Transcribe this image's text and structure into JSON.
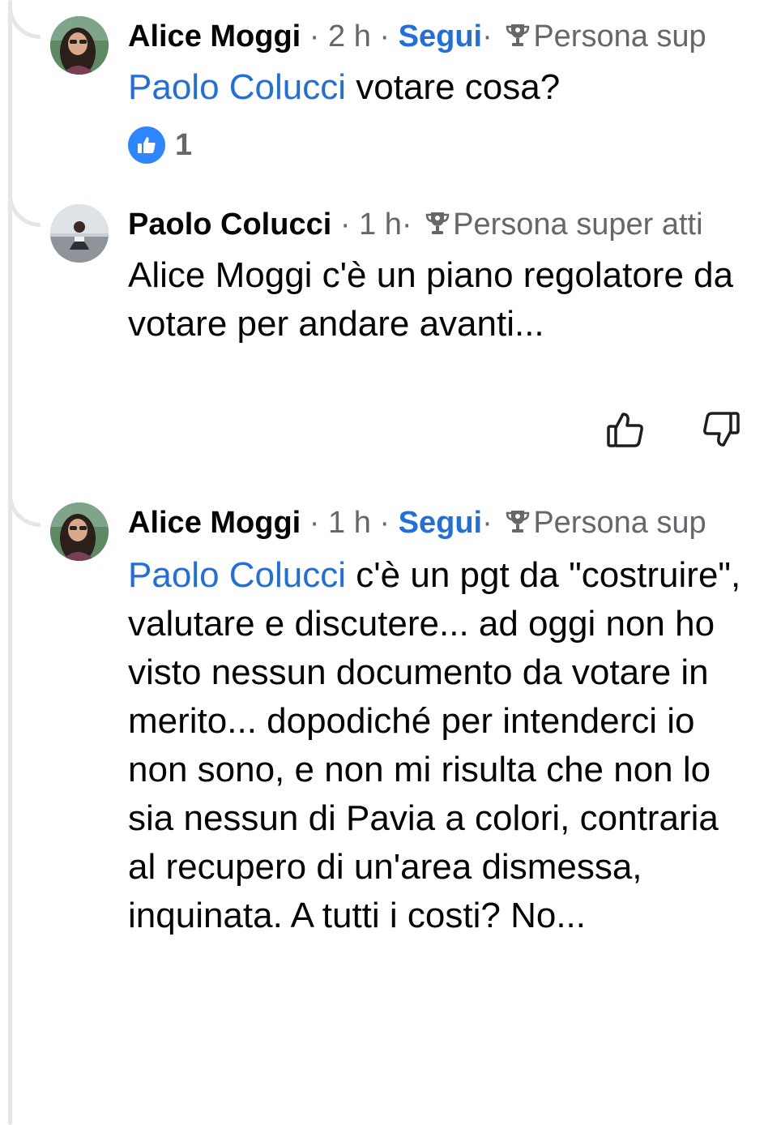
{
  "comments": [
    {
      "author": "Alice Moggi",
      "time": "· 2 h",
      "sep": "·",
      "follow": "Segui",
      "badge_sep": "·",
      "badge": "Persona sup",
      "mention": "Paolo Colucci",
      "text": " votare cosa?",
      "reaction_count": "1"
    },
    {
      "author": "Paolo Colucci",
      "time": "· 1 h",
      "badge_sep": "·",
      "badge": "Persona super atti",
      "text": "Alice Moggi c'è un piano regolatore da votare per andare avanti..."
    },
    {
      "author": "Alice Moggi",
      "time": "· 1 h",
      "sep": "·",
      "follow": "Segui",
      "badge_sep": "·",
      "badge": "Persona sup",
      "mention": "Paolo Colucci",
      "text": " c'è un pgt da \"costruire\", valutare e discutere... ad oggi non ho visto nessun documento da votare in merito... dopodiché per intenderci io non sono, e non mi risulta che non lo sia nessun di Pavia a colori, contraria al recupero di un'area dismessa, inquinata. A tutti i costi? No..."
    }
  ],
  "icons": {
    "avatar": "avatar",
    "trophy": "trophy-icon",
    "like_reaction": "like-reaction-icon",
    "upvote": "thumbs-up-icon",
    "downvote": "thumbs-down-icon"
  },
  "colors": {
    "link": "#216fdb",
    "meta": "#65676b",
    "like_badge": "#2d86ff"
  }
}
